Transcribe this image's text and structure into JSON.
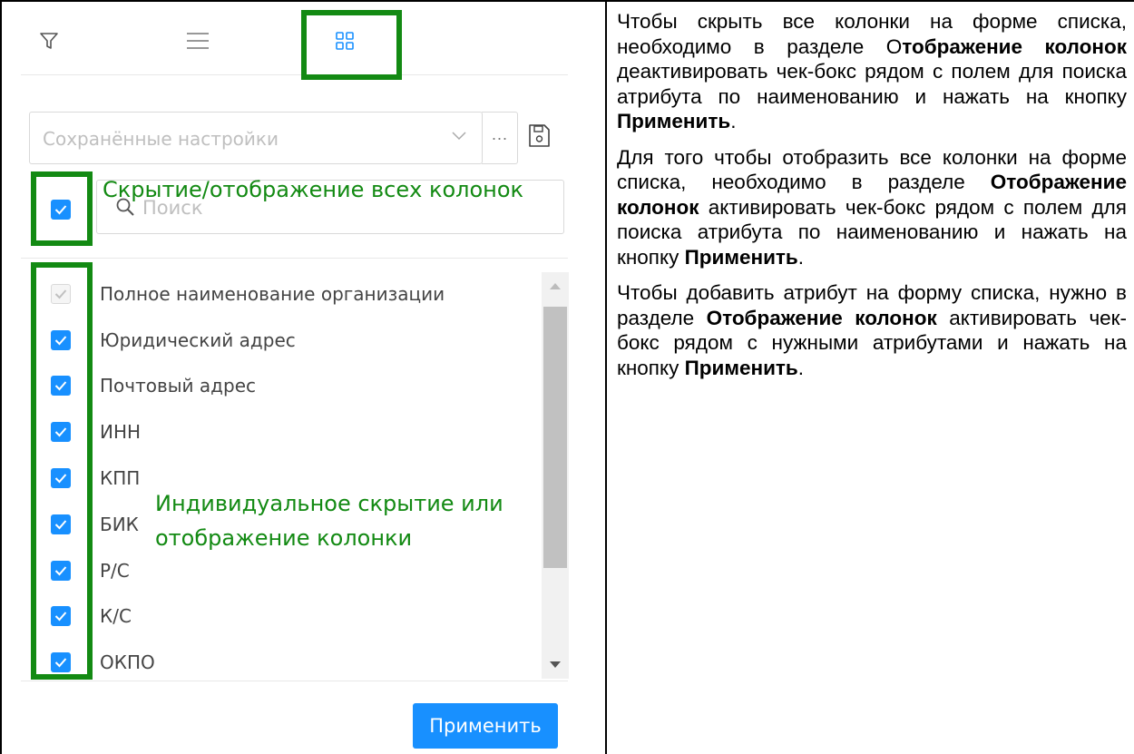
{
  "panel": {
    "tabs": [
      {
        "icon": "filter-icon"
      },
      {
        "icon": "list-icon"
      },
      {
        "icon": "grid-icon",
        "active": true
      }
    ],
    "saved_settings_placeholder": "Сохранённые настройки",
    "more_label": "···",
    "search_placeholder": "Поиск",
    "columns": [
      {
        "label": "Полное наименование организации",
        "checked": true,
        "disabled": true
      },
      {
        "label": "Юридический адрес",
        "checked": true
      },
      {
        "label": "Почтовый адрес",
        "checked": true
      },
      {
        "label": "ИНН",
        "checked": true
      },
      {
        "label": "КПП",
        "checked": true
      },
      {
        "label": "БИК",
        "checked": true
      },
      {
        "label": "Р/С",
        "checked": true
      },
      {
        "label": "К/С",
        "checked": true
      },
      {
        "label": "ОКПО",
        "checked": true
      }
    ],
    "apply_label": "Применить",
    "annotation_all": "Скрытие/отображение всех колонок",
    "annotation_individual_1": "Индивидуальное скрытие или",
    "annotation_individual_2": "отображение колонки",
    "accent_color": "#1890ff",
    "annotation_color": "#138a13"
  },
  "text": {
    "p1_a": "Чтобы скрыть все колонки на форме списка, необходимо в разделе О",
    "p1_b": "тображение колонок",
    "p1_c": " деактивировать чек-бокс рядом с полем для поиска атрибута по наименованию и нажать на кнопку ",
    "p1_d": "Применить",
    "p1_e": ".",
    "p2_a": "Для того чтобы отобразить все колонки на форме списка, необходимо в разделе ",
    "p2_b": "Отображение колонок",
    "p2_c": " активировать чек-бокс рядом с полем для поиска атрибута по наименованию и нажать на кнопку ",
    "p2_d": "Применить",
    "p2_e": ".",
    "p3_a": "Чтобы добавить атрибут на форму списка, нужно в разделе ",
    "p3_b": "Отображение колонок",
    "p3_c": " активировать чек-бокс рядом с нужными атрибутами и нажать на кнопку ",
    "p3_d": "Применить",
    "p3_e": "."
  }
}
